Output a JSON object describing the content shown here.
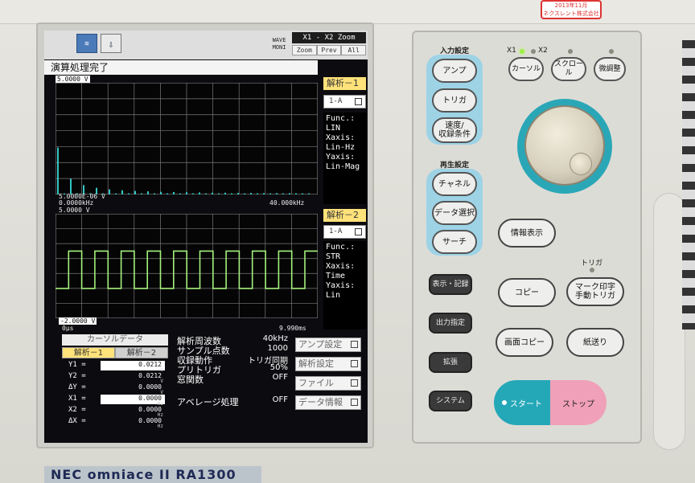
{
  "inspection_badge": {
    "line1": "2013年11月",
    "line2": "ネクスレント株式会社"
  },
  "screen": {
    "header": {
      "icon1": "≋",
      "icon2": "⇩",
      "wave_mode_line1": "WAVE",
      "wave_mode_line2": "MONI",
      "zoom_title": "X1 - X2 Zoom",
      "zoom_buttons": [
        "Zoom",
        "Prev",
        "All"
      ]
    },
    "status_message": "演算処理完了",
    "plot1": {
      "y_top": "5.0000 V",
      "y_bottom": "5.0000E-06 V",
      "x_left": "0.0000kHz",
      "x_right": "40.000kHz",
      "panel_label": "解析－1",
      "channel": "1-A",
      "info": [
        "Func.:",
        " LIN",
        "Xaxis:",
        " Lin-Hz",
        "Yaxis:",
        " Lin-Mag"
      ]
    },
    "plot2": {
      "y_top": "5.0000 V",
      "y_bottom": "-2.0000 V",
      "x_left": "0μs",
      "x_right": "9.990ms",
      "panel_label": "解析－2",
      "channel": "1-A",
      "info": [
        "Func.:",
        " STR",
        "Xaxis:",
        " Time",
        "Yaxis:",
        " Lin"
      ]
    },
    "cursor_data": {
      "title": "カーソルデータ",
      "tabs": [
        "解析－1",
        "解析－2"
      ],
      "rows": [
        {
          "label": "Y1 =",
          "value": "0.0212",
          "unit": "V"
        },
        {
          "label": "Y2 =",
          "value": "0.0212",
          "unit": "V"
        },
        {
          "label": "ΔY =",
          "value": "0.0000",
          "unit": "V"
        },
        {
          "label": "X1 =",
          "value": "0.0000",
          "unit": "Hz"
        },
        {
          "label": "X2 =",
          "value": "0.0000",
          "unit": "Hz"
        },
        {
          "label": "ΔX =",
          "value": "0.0000",
          "unit": "Hz"
        }
      ]
    },
    "params": [
      {
        "key": "解析周波数",
        "value": "40kHz"
      },
      {
        "key": "サンプル点数",
        "value": "1000"
      },
      {
        "key": "収録動作",
        "value": "トリガ同期"
      },
      {
        "key": "プリトリガ",
        "value": "50%"
      },
      {
        "key": "窓関数",
        "value": "OFF"
      },
      {
        "key": "",
        "value": ""
      },
      {
        "key": "アベレージ処理",
        "value": "OFF"
      }
    ],
    "menu_buttons": [
      "アンプ設定",
      "解析設定",
      "ファイル",
      "データ情報"
    ]
  },
  "chart_data": [
    {
      "type": "bar",
      "title": "",
      "x_range": [
        "0.0000kHz",
        "40.000kHz"
      ],
      "y_range": [
        "5.0000E-06 V",
        "5.0000 V"
      ],
      "grid": true,
      "values": [
        2.1,
        0.05,
        0.7,
        0.05,
        0.42,
        0.05,
        0.3,
        0.05,
        0.23,
        0.05,
        0.19,
        0.05,
        0.16,
        0.05,
        0.14,
        0.05,
        0.12,
        0.05,
        0.11,
        0.05,
        0.1,
        0.05,
        0.09,
        0.05,
        0.08,
        0.05,
        0.08,
        0.05,
        0.07,
        0.05,
        0.07,
        0.05,
        0.06,
        0.05,
        0.06,
        0.05,
        0.06,
        0.05,
        0.05,
        0.05
      ]
    },
    {
      "type": "line",
      "title": "",
      "x_range": [
        "0μs",
        "9.990ms"
      ],
      "y_range": [
        -2.0,
        5.0
      ],
      "grid": true,
      "series": [
        {
          "x": [
            0,
            0.5,
            0.5,
            1.0,
            1.0,
            1.5,
            1.5,
            2.0,
            2.0,
            2.5,
            2.5,
            3.0,
            3.0,
            3.5,
            3.5,
            4.0,
            4.0,
            4.5,
            4.5,
            5.0,
            5.0,
            5.5,
            5.5,
            6.0,
            6.0,
            6.5,
            6.5,
            7.0,
            7.0,
            7.5,
            7.5,
            8.0,
            8.0,
            8.5,
            8.5,
            9.0,
            9.0,
            9.5,
            9.5,
            9.99
          ],
          "y": [
            0,
            0,
            2.5,
            2.5,
            0,
            0,
            2.5,
            2.5,
            0,
            0,
            2.5,
            2.5,
            0,
            0,
            2.5,
            2.5,
            0,
            0,
            2.5,
            2.5,
            0,
            0,
            2.5,
            2.5,
            0,
            0,
            2.5,
            2.5,
            0,
            0,
            2.5,
            2.5,
            0,
            0,
            2.5,
            2.5,
            0,
            0,
            2.5,
            2.5
          ]
        }
      ]
    }
  ],
  "control_panel": {
    "input_section_label": "入力設定",
    "input_buttons": [
      "アンプ",
      "トリガ",
      "速度/\n収録条件"
    ],
    "play_section_label": "再生設定",
    "play_buttons": [
      "チャネル",
      "データ選択",
      "サーチ"
    ],
    "x_labels": [
      "X1",
      "X2"
    ],
    "cursor_buttons": [
      "カーソル",
      "スクロール",
      "微調整"
    ],
    "info_button": "情報表示",
    "dark_buttons": [
      "表示・記録",
      "出力指定",
      "拡張",
      "システム"
    ],
    "copy_button": "コピー",
    "trigger_label": "トリガ",
    "mark_button": "マーク印字\n手動トリガ",
    "screen_copy_button": "画面コピー",
    "feed_button": "紙送り",
    "start_button": "スタート",
    "stop_button": "ストップ"
  },
  "brand": "NEC omniace II RA1300",
  "colors": {
    "spectrum": "#35c6c3",
    "waveform": "#a4f27c",
    "grid": "#7a7a7a",
    "accent_blue": "#9ed3e6",
    "start": "#24a8b8",
    "stop": "#f0a0b8"
  }
}
